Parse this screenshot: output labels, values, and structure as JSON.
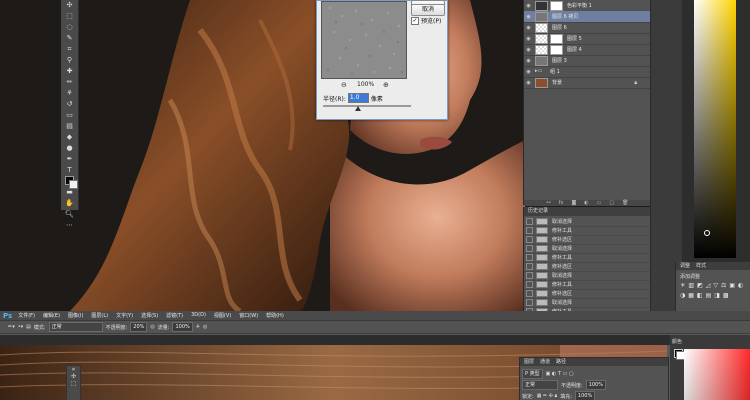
{
  "dialog": {
    "buttons_top": [
      "",
      ""
    ],
    "cancel_label": "取消",
    "preview_label": "预览(P)",
    "preview_checked": true,
    "zoom_out": "⊖",
    "zoom_value": "100%",
    "zoom_in": "⊕",
    "radius_label": "半径(R):",
    "radius_value": "1.0",
    "radius_unit": "像素"
  },
  "layers_panel": {
    "rows": [
      {
        "name": "色彩平衡 1",
        "thumb": "adjustment",
        "mask": true,
        "selected": false
      },
      {
        "name": "图层 6 拷贝",
        "thumb": "grey",
        "mask": false,
        "selected": true
      },
      {
        "name": "图层 6",
        "thumb": "checker",
        "mask": false,
        "selected": false
      },
      {
        "name": "图层 5",
        "thumb": "checker",
        "mask": true,
        "selected": false
      },
      {
        "name": "图层 4",
        "thumb": "checker",
        "mask": true,
        "selected": false
      },
      {
        "name": "图层 3",
        "thumb": "grey",
        "mask": false,
        "selected": false
      },
      {
        "name": "组 1",
        "thumb": "folder",
        "mask": false,
        "selected": false
      },
      {
        "name": "背景",
        "thumb": "photo",
        "mask": false,
        "selected": false,
        "locked": true
      }
    ],
    "footer_icons": [
      "link-icon",
      "fx-icon",
      "mask-icon",
      "adjust-icon",
      "folder-icon",
      "new-icon",
      "trash-icon"
    ]
  },
  "history_panel": {
    "tab_label": "历史记录",
    "items": [
      "取消选择",
      "修补工具",
      "修补选区",
      "取消选择",
      "修补工具",
      "修补选区",
      "取消选择",
      "修补工具",
      "修补选区",
      "取消选择",
      "修补工具",
      "修补选区"
    ]
  },
  "adjustments_panel": {
    "tabs": [
      "调整",
      "样式"
    ],
    "subtitle": "添加调整",
    "icons": [
      "☀",
      "▥",
      "◩",
      "◿",
      "▽",
      "⚖",
      "▣",
      "◐",
      "◑",
      "▦",
      "◧",
      "▤",
      "◨",
      "▩"
    ]
  },
  "menubar": {
    "logo": "Ps",
    "items": [
      "文件(F)",
      "编辑(E)",
      "图像(I)",
      "图层(L)",
      "文字(Y)",
      "选择(S)",
      "滤镜(T)",
      "3D(D)",
      "视图(V)",
      "窗口(W)",
      "帮助(H)"
    ]
  },
  "options_bar": {
    "mode_label": "模式:",
    "mode_value": "正常",
    "opacity_label": "不透明度:",
    "opacity_value": "20%",
    "flow_label": "流量:",
    "flow_value": "100%"
  },
  "layers_bottom": {
    "tabs": [
      "图层",
      "通道",
      "路径"
    ],
    "kind_label": "P 类型",
    "blend_value": "正常",
    "opacity_label": "不透明度:",
    "opacity_value": "100%",
    "lock_label": "锁定:",
    "fill_label": "填充:",
    "fill_value": "100%"
  },
  "color_bottom": {
    "tab_label": "颜色"
  },
  "colors": {
    "ps_blue": "#4db6ff",
    "selected_layer": "#6f7fa0",
    "radius_highlight": "#3d7ad6"
  }
}
